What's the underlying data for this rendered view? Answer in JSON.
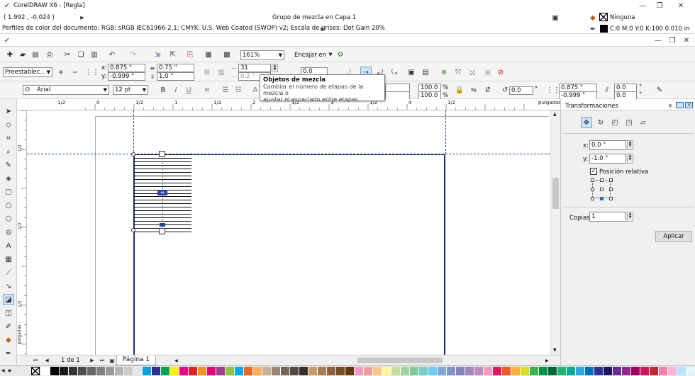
{
  "title_bar": {
    "app_title": "CorelDRAW X6 - [Regla]"
  },
  "status_top": {
    "coords": "( 1.992 , -0.024 )",
    "object_info": "Grupo de mezcla en Capa 1",
    "fill_label": "Ninguna",
    "outline_label": "C:0 M:0 Y:0 K:100  0.010 in"
  },
  "status_bottom": {
    "color_profile": "Perfiles de color del documento: RGB: sRGB IEC61966-2.1; CMYK: U.S. Web Coated (SWOP) v2; Escala de grises: Dot Gain 20%"
  },
  "standard_toolbar": {
    "zoom": "161%",
    "snap_label": "Encajar en"
  },
  "property_bar": {
    "preset": "Preestablec...",
    "x": "0.875 \"",
    "y": "-0.999 \"",
    "w": "0.75 \"",
    "h": "1.0 \"",
    "steps": "31",
    "spacing": "0.2 \"",
    "accel": "0.0"
  },
  "text_bar": {
    "font": "Arial",
    "size": "12 pt",
    "scale_w": "100.0",
    "scale_h": "100.0",
    "percent": "%",
    "rotation": "0.0",
    "pos_x": "0.875 \"",
    "pos_y": "-0.999 \"",
    "skew_x": "0.0",
    "skew_y": "0.0",
    "degree": "°"
  },
  "tooltip": {
    "title": "Objetos de mezcla",
    "body1": "Cambiar el número de etapas de la mezcla o",
    "body2": "ajustar el espaciado entre etapas."
  },
  "ruler": {
    "unit": "pulgadas",
    "v_unit": "pulgadas",
    "ticks": [
      {
        "label": "1/2"
      },
      {
        "label": "0"
      },
      {
        "label": "1/2"
      },
      {
        "label": "1"
      },
      {
        "label": "1/2"
      },
      {
        "label": "2"
      },
      {
        "label": "1/2"
      },
      {
        "label": "3"
      },
      {
        "label": "1/2"
      },
      {
        "label": "4"
      },
      {
        "label": "1/2"
      }
    ],
    "vticks": [
      {
        "label": "1/2"
      },
      {
        "label": "1/2"
      },
      {
        "label": "1/2"
      }
    ]
  },
  "blend": {
    "line_count": 23
  },
  "docker": {
    "title": "Transformaciones",
    "x_label": "x:",
    "x_value": "0.0 \"",
    "y_label": "y:",
    "y_value": "-1.0 \"",
    "relative_label": "Posición relativa",
    "copies_label": "Copias:",
    "copies_value": "1",
    "apply_label": "Aplicar"
  },
  "page_nav": {
    "page_count": "1 de 1",
    "page_tab": "Página 1"
  },
  "colors": {
    "accent": "#1e73be",
    "guide": "#1a3fa8",
    "page_border": "#1b2a6b"
  },
  "palette": [
    "#ffffff",
    "#000000",
    "#1a1a1a",
    "#333333",
    "#4d4d4d",
    "#666666",
    "#808080",
    "#999999",
    "#b3b3b3",
    "#cccccc",
    "#e6e6e6",
    "#00a0e3",
    "#2e3192",
    "#00a651",
    "#fff200",
    "#ec008c",
    "#ed1c24",
    "#f7941d",
    "#e6007e",
    "#a03b8f",
    "#8dc63f",
    "#00aeef",
    "#f26522",
    "#fbaf5d",
    "#c7b299",
    "#998675",
    "#736357",
    "#534741",
    "#362f2d",
    "#c69c6d",
    "#a67c52",
    "#8c6239",
    "#754c24",
    "#603913",
    "#f49ac2",
    "#f6989d",
    "#fdc68a",
    "#fff799",
    "#c4df9b",
    "#a3d39c",
    "#82ca9c",
    "#7accc8",
    "#6dcff6",
    "#7da7d9",
    "#8393ca",
    "#8781bd",
    "#a186be",
    "#bd8cbf",
    "#f49ac1",
    "#ee145b",
    "#f15a24",
    "#fbb040",
    "#d9e021",
    "#39b54a",
    "#009245",
    "#006837",
    "#22b573",
    "#00a99d",
    "#29abe2",
    "#0071bc",
    "#2e3192",
    "#1b1464",
    "#662d91",
    "#93278f",
    "#9e005d",
    "#d4145a",
    "#c1272d",
    "#ff7bac",
    "#ffb3d9",
    "#b3e5fc",
    "#e0f7fa",
    "#dcedc8"
  ]
}
